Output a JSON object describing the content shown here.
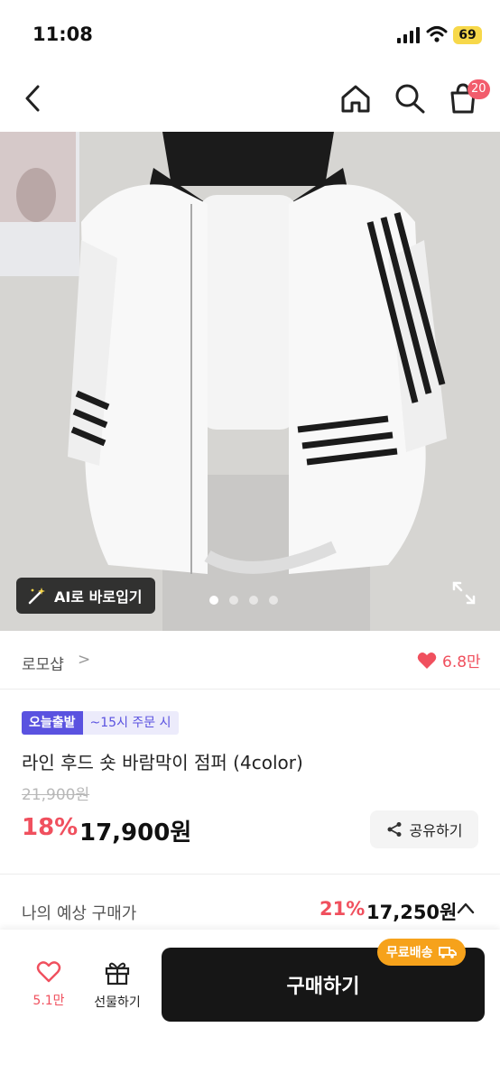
{
  "status_bar": {
    "time": "11:08",
    "battery": "69"
  },
  "nav": {
    "cart_count": "20"
  },
  "gallery": {
    "ai_button_label": "AI로 바로입기",
    "page_count": 4,
    "active_page": 1
  },
  "shop": {
    "name": "로모샵",
    "chevron": ">",
    "likes": "6.8만"
  },
  "product": {
    "badge_today": "오늘출발",
    "badge_deadline": "~15시 주문 시",
    "title": "라인 후드 숏 바람막이 점퍼 (4color)",
    "original_price": "21,900원",
    "discount_rate": "18%",
    "sale_price": "17,900원",
    "share_label": "공유하기"
  },
  "expected": {
    "label": "나의 예상 구매가",
    "rate": "21%",
    "price": "17,250원"
  },
  "bottom_bar": {
    "like_count": "5.1만",
    "gift_label": "선물하기",
    "buy_label": "구매하기",
    "free_ship_label": "무료배송"
  },
  "colors": {
    "accent_red": "#f0505e",
    "badge_purple": "#5a52e0",
    "free_ship_orange": "#f6a21b",
    "buy_button": "#161616"
  },
  "icons": [
    "back-arrow-icon",
    "home-icon",
    "search-icon",
    "shopping-bag-icon",
    "magic-wand-icon",
    "expand-icon",
    "heart-icon",
    "share-icon",
    "chevron-up-icon",
    "gift-icon",
    "truck-icon"
  ]
}
